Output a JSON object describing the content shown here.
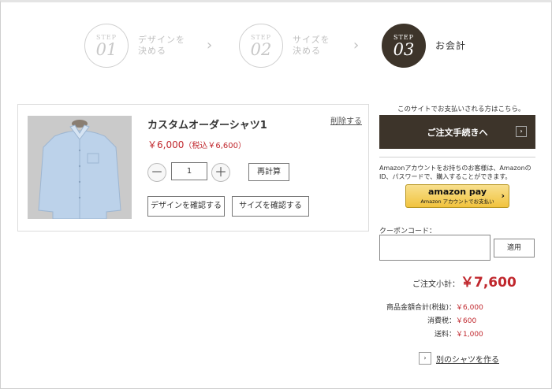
{
  "steps": [
    {
      "label": "STEP",
      "num": "01",
      "text": "デザインを\n決める"
    },
    {
      "label": "STEP",
      "num": "02",
      "text": "サイズを\n決める"
    },
    {
      "label": "STEP",
      "num": "03",
      "text": "お会計"
    }
  ],
  "cart": {
    "product_name": "カスタムオーダーシャツ1",
    "delete_label": "削除する",
    "price": "￥6,000",
    "price_tax": "（税込￥6,600）",
    "quantity": "1",
    "minus": "－",
    "plus": "＋",
    "recalc_label": "再計算",
    "confirm_design_label": "デザインを確認する",
    "confirm_size_label": "サイズを確認する"
  },
  "payment": {
    "note": "このサイトでお支払いされる方はこちら。",
    "checkout_label": "ご注文手続きへ",
    "arrow": "›",
    "amazon_note": "Amazonアカウントをお持ちのお客様は、Amazonの\nID、パスワードで、購入することができます。",
    "amazon_pay_label": "amazon pay",
    "amazon_pay_sub": "Amazon アカウントでお支払い",
    "amazon_arrow": "›"
  },
  "coupon": {
    "label": "クーポンコード：",
    "value": "",
    "apply_label": "適用"
  },
  "summary": {
    "subtotal_label": "ご注文小計：",
    "subtotal_value": "￥7,600",
    "rows": [
      {
        "label": "商品金額合計(税抜)：",
        "value": "￥6,000"
      },
      {
        "label": "消費税：",
        "value": "￥600"
      },
      {
        "label": "送料：",
        "value": "￥1,000"
      }
    ]
  },
  "another_shirt_label": "別のシャツを作る",
  "colors": {
    "accent": "#3d342a",
    "price": "#c0272d",
    "amazon": "#f1c33e"
  }
}
